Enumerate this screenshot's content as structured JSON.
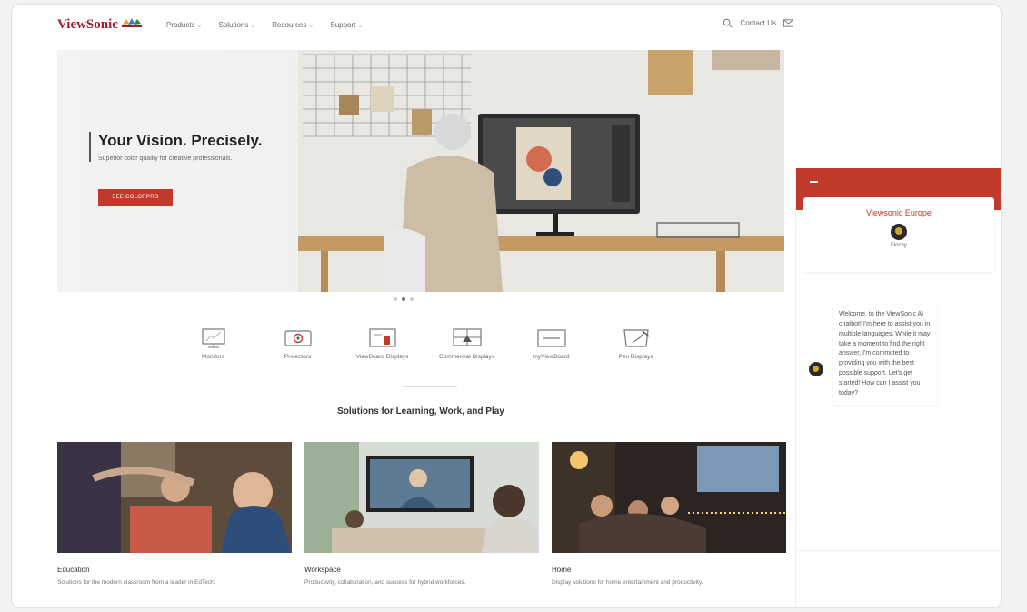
{
  "header": {
    "logo": "ViewSonic",
    "nav": [
      {
        "label": "Products"
      },
      {
        "label": "Solutions"
      },
      {
        "label": "Resources"
      },
      {
        "label": "Support"
      }
    ],
    "contact": "Contact Us"
  },
  "hero": {
    "title": "Your Vision. Precisely.",
    "subtitle": "Superior color quality for creative professionals.",
    "button": "SEE COLORPRO",
    "slides": 3,
    "active_slide": 2
  },
  "categories": [
    {
      "label": "Monitors",
      "icon": "monitor-icon"
    },
    {
      "label": "Projectors",
      "icon": "projector-icon"
    },
    {
      "label": "ViewBoard Displays",
      "icon": "viewboard-icon"
    },
    {
      "label": "Commercial Displays",
      "icon": "commercial-display-icon"
    },
    {
      "label": "myViewBoard",
      "icon": "myviewboard-icon"
    },
    {
      "label": "Pen Displays",
      "icon": "pen-display-icon"
    }
  ],
  "solutions": {
    "title": "Solutions for Learning, Work, and Play",
    "cards": [
      {
        "title": "Education",
        "desc": "Solutions for the modern classroom from a leader in EdTech."
      },
      {
        "title": "Workspace",
        "desc": "Productivity, collaboration, and success for hybrid workforces."
      },
      {
        "title": "Home",
        "desc": "Display solutions for home entertainment and productivity."
      }
    ]
  },
  "chat": {
    "company": "Viewsonic Europe",
    "bot_name": "Finchy",
    "message": "Welcome, to the ViewSonic AI chatbot! I'm here to assist you in multiple languages. While it may take a moment to find the right answer, I'm committed to providing you with the best possible support. Let's get started! How can I assist you today?"
  },
  "colors": {
    "brand": "#a6192e",
    "accent": "#c0392b"
  }
}
